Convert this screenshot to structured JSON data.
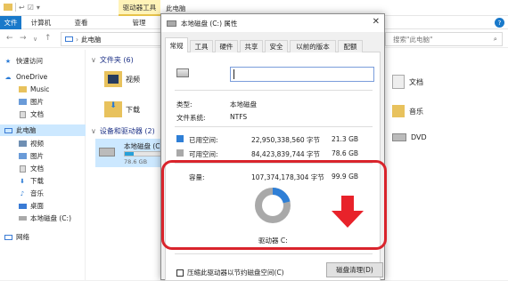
{
  "explorer": {
    "qat_items": [
      "↩",
      "☑",
      "▾"
    ],
    "context_tab": "驱动器工具",
    "window_title": "此电脑",
    "ribbon_tabs": [
      "文件",
      "计算机",
      "查看",
      "管理"
    ],
    "help": "?",
    "address": {
      "crumbs": [
        "此电脑"
      ],
      "refresh": "⟳"
    },
    "search_placeholder": "搜索\"此电脑\"",
    "nav": [
      "快速访问",
      "OneDrive",
      "Music",
      "图片",
      "文档",
      "此电脑",
      "视频",
      "图片",
      "文档",
      "下载",
      "音乐",
      "桌面",
      "本地磁盘 (C:)",
      "网络"
    ],
    "folders_header": "文件夹 (6)",
    "devices_header": "设备和驱动器 (2)",
    "folder_items": [
      "视频",
      "下载"
    ],
    "drive": {
      "label": "本地磁盘 (C:",
      "free_text": "78.6 GB",
      "used_fraction": 0.21
    },
    "right_items": [
      "文档",
      "音乐"
    ],
    "right_drive": "DVD"
  },
  "dialog": {
    "title": "本地磁盘 (C:) 属性",
    "close": "✕",
    "tabs": [
      "常规",
      "工具",
      "硬件",
      "共享",
      "安全",
      "以前的版本",
      "配额"
    ],
    "active_tab": "常规",
    "name_value": "",
    "type_label": "类型:",
    "type_value": "本地磁盘",
    "fs_label": "文件系统:",
    "fs_value": "NTFS",
    "used_label": "已用空间:",
    "used_bytes": "22,950,338,560 字节",
    "used_gb": "21.3 GB",
    "free_label": "可用空间:",
    "free_bytes": "84,423,839,744 字节",
    "free_gb": "78.6 GB",
    "cap_label": "容量:",
    "cap_bytes": "107,374,178,304 字节",
    "cap_gb": "99.9 GB",
    "drive_label": "驱动器 C:",
    "cleanup_button": "磁盘清理(D)",
    "compress_label": "压缩此驱动器以节约磁盘空间(C)",
    "used_fraction": 0.2137,
    "colors": {
      "used": "#2f7fd6",
      "free": "#a9a9a9",
      "highlight": "#d9242c",
      "arrow": "#e8222a"
    }
  }
}
